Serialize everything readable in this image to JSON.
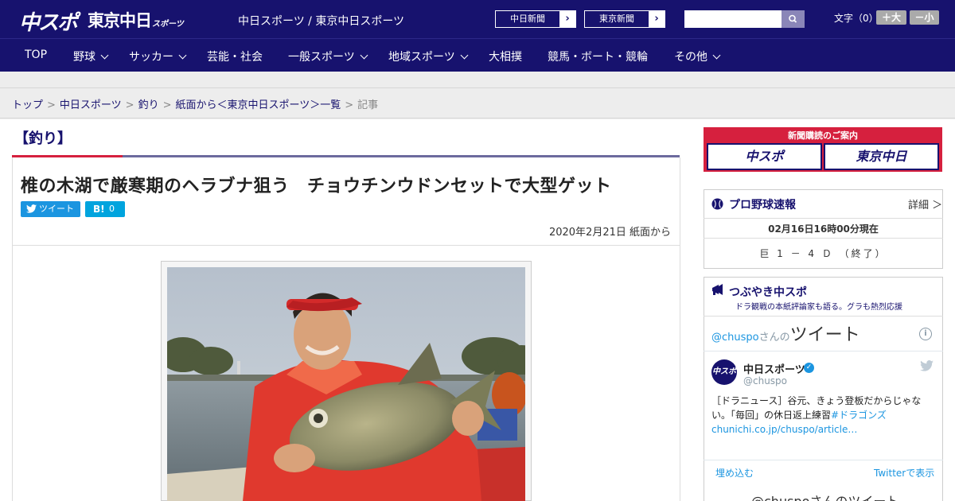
{
  "header": {
    "logo_main": "中スポ",
    "logo_tokyo": "東京中日",
    "logo_tokyo_small": "スポーツ",
    "site_names": "中日スポーツ / 東京中日スポーツ",
    "chunichi_link": "中日新聞",
    "tokyo_link": "東京新聞",
    "search_placeholder": "",
    "font_size_label": "文字（0）",
    "font_larger": "＋大",
    "font_smaller": "－小"
  },
  "nav": {
    "items": [
      {
        "label": "TOP",
        "dropdown": false
      },
      {
        "label": "野球",
        "dropdown": true
      },
      {
        "label": "サッカー",
        "dropdown": true
      },
      {
        "label": "芸能・社会",
        "dropdown": false
      },
      {
        "label": "一般スポーツ",
        "dropdown": true
      },
      {
        "label": "地域スポーツ",
        "dropdown": true
      },
      {
        "label": "大相撲",
        "dropdown": false
      },
      {
        "label": "競馬・ボート・競輪",
        "dropdown": false
      },
      {
        "label": "その他",
        "dropdown": true
      }
    ]
  },
  "breadcrumb": {
    "items": [
      "トップ",
      "中日スポーツ",
      "釣り",
      "紙面から＜東京中日スポーツ＞一覧"
    ],
    "current": "記事"
  },
  "article": {
    "category": "【釣り】",
    "title": "椎の木湖で厳寒期のヘラブナ狙う　チョウチンウドンセットで大型ゲット",
    "tweet_label": "ツイート",
    "hatena_label": "B!",
    "hatena_count": "0",
    "date": "2020年2月21日 紙面から"
  },
  "sidebar": {
    "subscribe_header": "新聞購読のご案内",
    "subscribe_chuspo": "中スポ",
    "subscribe_tokyo": "東京中日",
    "baseball": {
      "title": "プロ野球速報",
      "detail": "詳細 ＞",
      "time": "02月16日16時00分現在",
      "score": "巨 1 － 4 Ｄ （終了）"
    },
    "twitter": {
      "title": "つぶやき中スポ",
      "subtitle": "ドラ観戦の本紙評論家も語る。グラも熱烈応援",
      "head_handle": "@chuspo",
      "head_san": "さんの",
      "head_big": "ツイート",
      "name": "中日スポーツ",
      "handle": "@chuspo",
      "text_plain": "［ドラニュース］谷元、きょう登板だからじゃない。「毎回」の休日返上練習",
      "text_tag": "#ドラゴンズ",
      "text_link": "chunichi.co.jp/chuspo/article…",
      "embed": "埋め込む",
      "view_on_twitter": "Twitterで表示",
      "more": "@chuspoさんのツイート"
    }
  },
  "colors": {
    "brand_navy": "#17126e",
    "accent_red": "#d6203e",
    "twitter_blue": "#1b95e0"
  }
}
